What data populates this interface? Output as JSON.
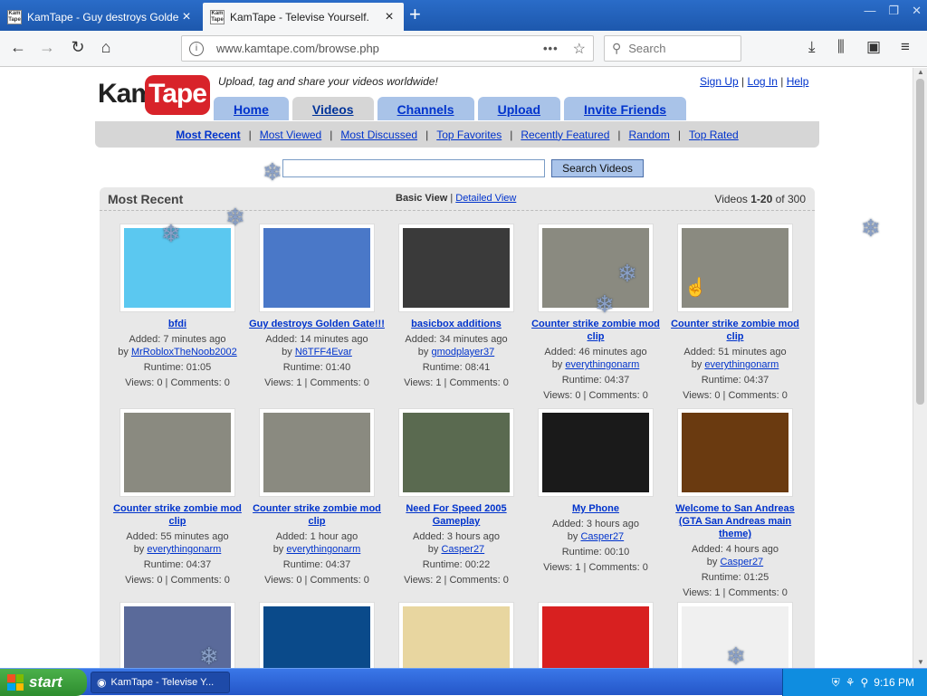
{
  "browser": {
    "tabs": [
      {
        "title": "KamTape - Guy destroys Golden Gate!!!",
        "favicon": "Kam Tape",
        "active": false
      },
      {
        "title": "KamTape - Televise Yourself.",
        "favicon": "Kam Tape",
        "active": true
      }
    ],
    "new_tab": "+",
    "window_controls": {
      "minimize": "—",
      "maximize": "❐",
      "close": "✕"
    },
    "url": "www.kamtape.com/browse.php",
    "page_actions": "•••",
    "search_placeholder": "Search"
  },
  "site": {
    "logo_left": "Kam",
    "logo_right": "Tape",
    "tagline": "Upload, tag and share your videos worldwide!",
    "top_links": {
      "signup": "Sign Up",
      "login": "Log In",
      "help": "Help",
      "sep": "|"
    },
    "main_tabs": [
      "Home",
      "Videos",
      "Channels",
      "Upload",
      "Invite Friends"
    ],
    "active_tab": "Videos",
    "sub_nav": [
      "Most Recent",
      "Most Viewed",
      "Most Discussed",
      "Top Favorites",
      "Recently Featured",
      "Random",
      "Top Rated"
    ],
    "search_button": "Search Videos",
    "search_value": ""
  },
  "panel": {
    "title": "Most Recent",
    "basic_view": "Basic View",
    "view_sep": "|",
    "detailed_view": "Detailed View",
    "count_prefix": "Videos",
    "count_range": "1-20",
    "count_suffix": "of 300"
  },
  "videos": [
    {
      "title": "bfdi",
      "added": "Added: 7 minutes ago",
      "by": "MrRobloxTheNoob2002",
      "runtime": "Runtime: 01:05",
      "stats": "Views: 0 | Comments: 0",
      "color": "#5bc8f0"
    },
    {
      "title": "Guy destroys Golden Gate!!!",
      "added": "Added: 14 minutes ago",
      "by": "N6TFF4Evar",
      "runtime": "Runtime: 01:40",
      "stats": "Views: 1 | Comments: 0",
      "color": "#4a78c8"
    },
    {
      "title": "basicbox additions",
      "added": "Added: 34 minutes ago",
      "by": "gmodplayer37",
      "runtime": "Runtime: 08:41",
      "stats": "Views: 1 | Comments: 0",
      "color": "#3a3a3a"
    },
    {
      "title": "Counter strike zombie mod clip",
      "added": "Added: 46 minutes ago",
      "by": "everythingonarm",
      "runtime": "Runtime: 04:37",
      "stats": "Views: 0 | Comments: 0",
      "color": "#8a8a80"
    },
    {
      "title": "Counter strike zombie mod clip",
      "added": "Added: 51 minutes ago",
      "by": "everythingonarm",
      "runtime": "Runtime: 04:37",
      "stats": "Views: 0 | Comments: 0",
      "color": "#8a8a80"
    },
    {
      "title": "Counter strike zombie mod clip",
      "added": "Added: 55 minutes ago",
      "by": "everythingonarm",
      "runtime": "Runtime: 04:37",
      "stats": "Views: 0 | Comments: 0",
      "color": "#8a8a80"
    },
    {
      "title": "Counter strike zombie mod clip",
      "added": "Added: 1 hour ago",
      "by": "everythingonarm",
      "runtime": "Runtime: 04:37",
      "stats": "Views: 0 | Comments: 0",
      "color": "#8a8a80"
    },
    {
      "title": "Need For Speed 2005 Gameplay",
      "added": "Added: 3 hours ago",
      "by": "Casper27",
      "runtime": "Runtime: 00:22",
      "stats": "Views: 2 | Comments: 0",
      "color": "#5a6a50"
    },
    {
      "title": "My Phone",
      "added": "Added: 3 hours ago",
      "by": "Casper27",
      "runtime": "Runtime: 00:10",
      "stats": "Views: 1 | Comments: 0",
      "color": "#1a1a1a"
    },
    {
      "title": "Welcome to San Andreas (GTA San Andreas main theme)",
      "added": "Added: 4 hours ago",
      "by": "Casper27",
      "runtime": "Runtime: 01:25",
      "stats": "Views: 1 | Comments: 0",
      "color": "#6a3a10"
    },
    {
      "title": "",
      "added": "",
      "by": "",
      "runtime": "",
      "stats": "",
      "color": "#5a6a9a"
    },
    {
      "title": "",
      "added": "",
      "by": "",
      "runtime": "",
      "stats": "",
      "color": "#0a4a8a"
    },
    {
      "title": "",
      "added": "",
      "by": "",
      "runtime": "",
      "stats": "",
      "color": "#e8d6a0"
    },
    {
      "title": "",
      "added": "",
      "by": "",
      "runtime": "",
      "stats": "",
      "color": "#d82020"
    },
    {
      "title": "",
      "added": "",
      "by": "",
      "runtime": "",
      "stats": "",
      "color": "#f0f0f0"
    }
  ],
  "taskbar": {
    "start": "start",
    "window": "KamTape - Televise Y...",
    "clock": "9:16 PM"
  }
}
